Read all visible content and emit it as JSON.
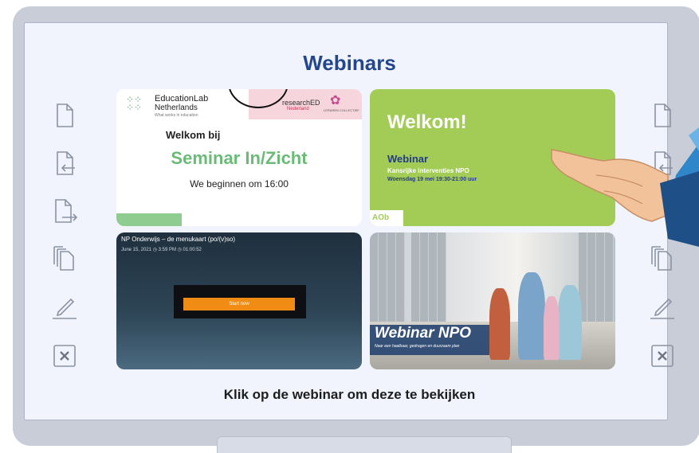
{
  "page": {
    "title": "Webinars",
    "footer": "Klik op de webinar om deze te bekijken"
  },
  "cards": [
    {
      "logo_title": "EducationLab",
      "logo_subtitle": "Netherlands",
      "logo_tagline": "What works in education",
      "partner": "researchED",
      "partner_sub": "Nederland",
      "partner2": "LERAREN COLLECTIEF",
      "welkom": "Welkom bij",
      "title": "Seminar In/Zicht",
      "subtitle": "We beginnen om 16:00"
    },
    {
      "welkom": "Welkom!",
      "title": "Webinar",
      "subtitle": "Kansrijke interventies NPO",
      "date": "Woensdag 19 mei  19:30-21:00 uur",
      "brand": "AOb"
    },
    {
      "title": "NP Onderwijs – de menukaart (po/(v)so)",
      "meta": "June 15, 2021   ◷ 3:59 PM   ◷ 01:00:52",
      "button": "Start now"
    },
    {
      "title": "Webinar NPO",
      "subtitle": "Naar een haalbaar, gedragen en duurzaam plan"
    }
  ],
  "colors": {
    "title": "#23468d",
    "card2_bg": "#a3cc57",
    "start_button": "#f08c14",
    "seminar_green": "#6cba77"
  }
}
